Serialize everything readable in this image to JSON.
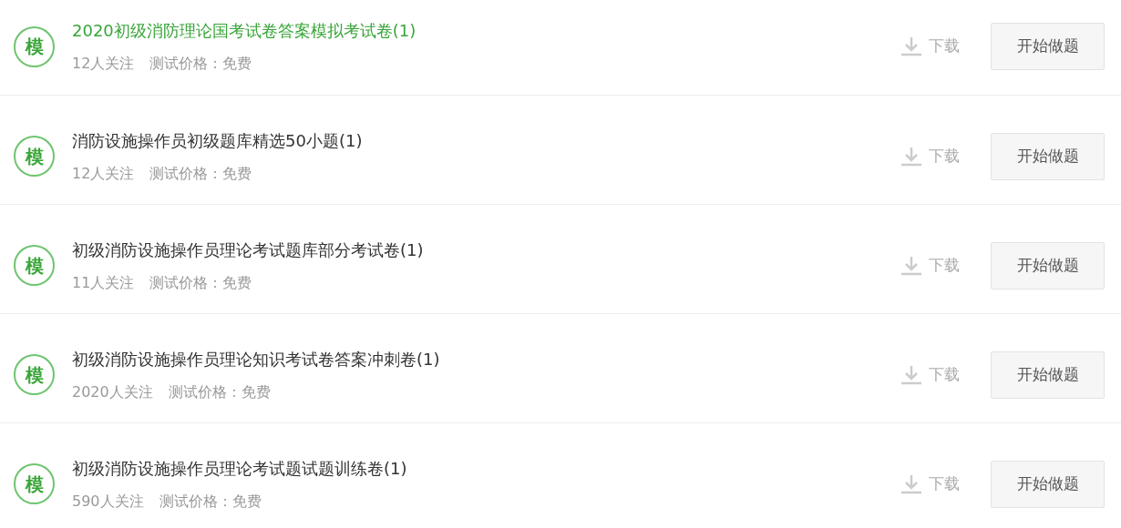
{
  "exams": [
    {
      "badge": "模",
      "title": "2020初级消防理论国考试卷答案模拟考试卷(1)",
      "highlighted": true,
      "followers": "12人关注",
      "price": "测试价格：免费",
      "download": "下载",
      "start": "开始做题"
    },
    {
      "badge": "模",
      "title": "消防设施操作员初级题库精选50小题(1)",
      "highlighted": false,
      "followers": "12人关注",
      "price": "测试价格：免费",
      "download": "下载",
      "start": "开始做题"
    },
    {
      "badge": "模",
      "title": "初级消防设施操作员理论考试题库部分考试卷(1)",
      "highlighted": false,
      "followers": "11人关注",
      "price": "测试价格：免费",
      "download": "下载",
      "start": "开始做题"
    },
    {
      "badge": "模",
      "title": "初级消防设施操作员理论知识考试卷答案冲刺卷(1)",
      "highlighted": false,
      "followers": "2020人关注",
      "price": "测试价格：免费",
      "download": "下载",
      "start": "开始做题"
    },
    {
      "badge": "模",
      "title": "初级消防设施操作员理论考试题试题训练卷(1)",
      "highlighted": false,
      "followers": "590人关注",
      "price": "测试价格：免费",
      "download": "下载",
      "start": "开始做题"
    }
  ]
}
